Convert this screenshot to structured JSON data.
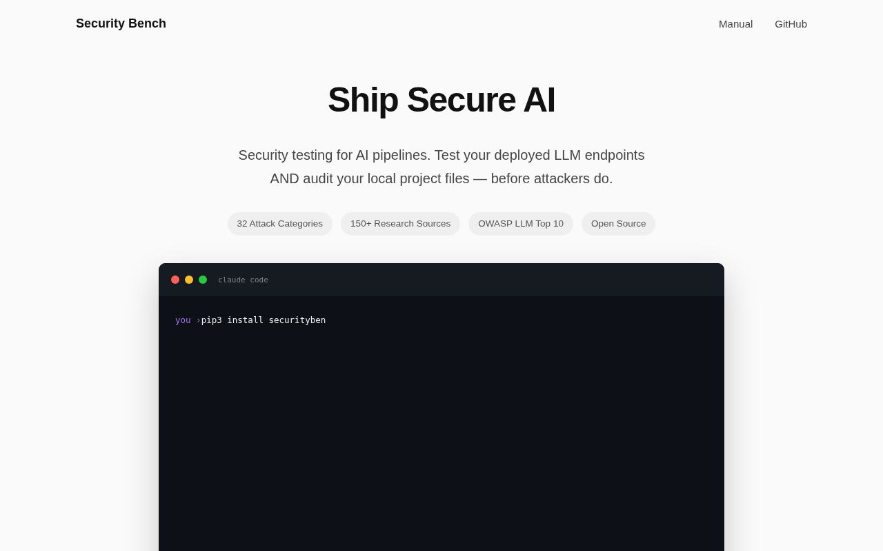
{
  "nav": {
    "brand": "Security Bench",
    "links": [
      "Manual",
      "GitHub"
    ]
  },
  "hero": {
    "title": "Ship Secure AI",
    "subtitle_lines": [
      "Security testing for AI pipelines. Test your deployed LLM endpoints",
      "AND audit your local project files — before attackers do."
    ],
    "badges": [
      "32 Attack Categories",
      "150+ Research Sources",
      "OWASP LLM Top 10",
      "Open Source"
    ]
  },
  "terminal": {
    "dots": [
      {
        "color": "#ff5f57"
      },
      {
        "color": "#febc2e"
      },
      {
        "color": "#28c840"
      }
    ],
    "title": "claude code",
    "lines": [
      {
        "prompt": "you ›",
        "command": "pip3 install securityben"
      }
    ]
  }
}
